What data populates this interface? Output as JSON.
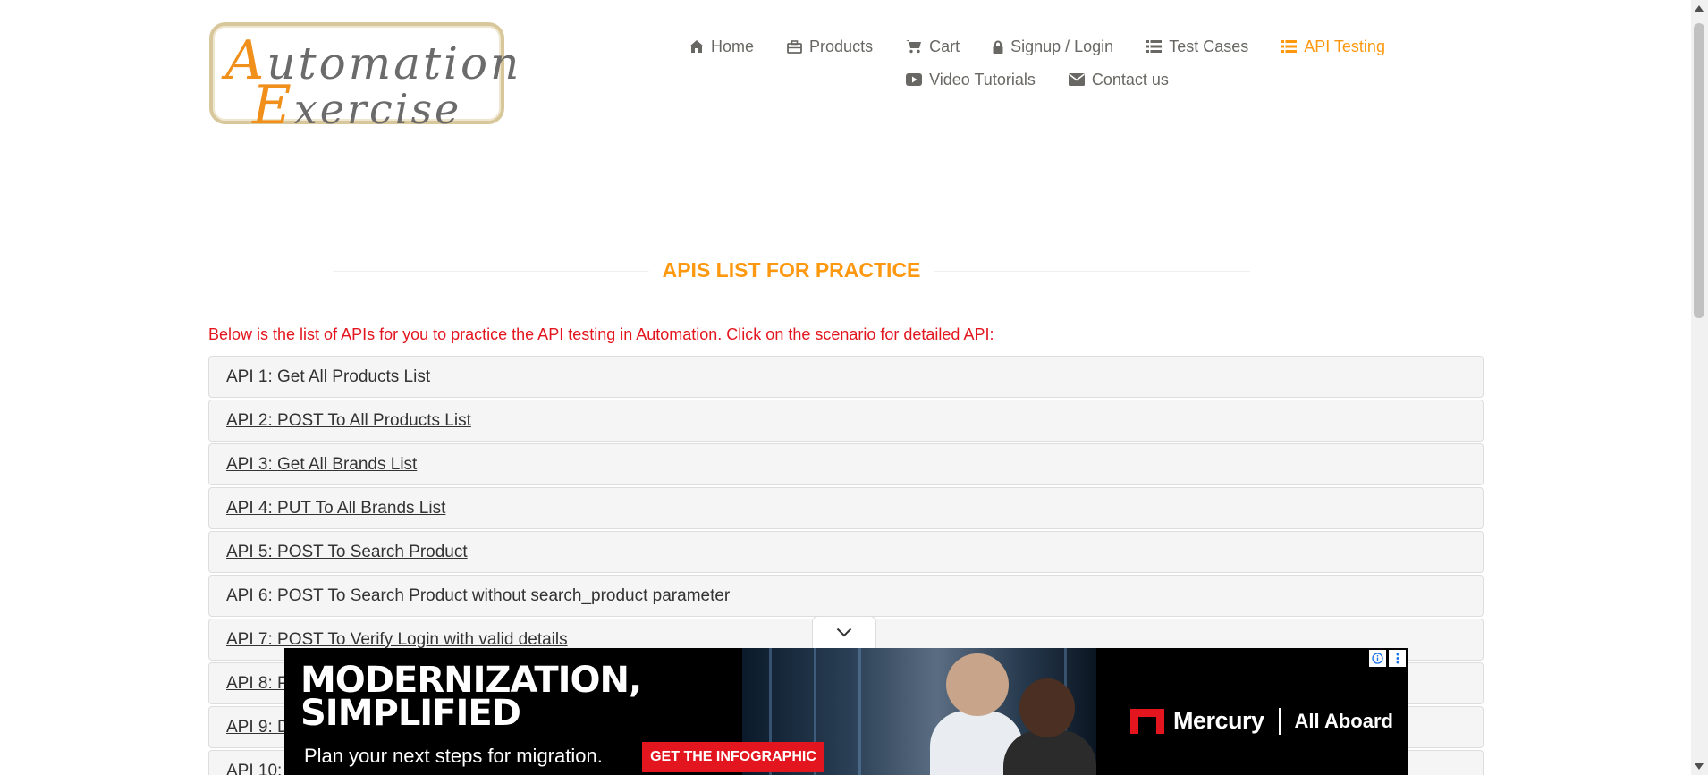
{
  "logo": {
    "line1_cap": "A",
    "line1_rest": "utomation",
    "line2_cap": "E",
    "line2_rest": "xercise"
  },
  "nav": {
    "row1": [
      {
        "label": "Home",
        "icon": "home-icon"
      },
      {
        "label": "Products",
        "icon": "briefcase-icon"
      },
      {
        "label": "Cart",
        "icon": "cart-icon"
      },
      {
        "label": "Signup / Login",
        "icon": "lock-icon"
      },
      {
        "label": "Test Cases",
        "icon": "list-icon"
      },
      {
        "label": "API Testing",
        "icon": "list-icon",
        "active": true
      }
    ],
    "row2": [
      {
        "label": "Video Tutorials",
        "icon": "youtube-play-icon"
      },
      {
        "label": "Contact us",
        "icon": "envelope-icon"
      }
    ]
  },
  "page_title": "APIs List for practice",
  "intro": "Below is the list of APIs for you to practice the API testing in Automation. Click on the scenario for detailed API:",
  "apis": [
    "API 1: Get All Products List",
    "API 2: POST To All Products List",
    "API 3: Get All Brands List",
    "API 4: PUT To All Brands List",
    "API 5: POST To Search Product",
    "API 6: POST To Search Product without search_product parameter",
    "API 7: POST To Verify Login with valid details",
    "API 8: P",
    "API 9: D",
    "API 10:"
  ],
  "ad": {
    "headline": "MODERNIZATION,\nSIMPLIFIED",
    "subtext": "Plan your next steps for migration.",
    "cta": "GET THE INFOGRAPHIC",
    "brand": "Mercury",
    "tagline": "All Aboard"
  },
  "colors": {
    "accent": "#fe980f",
    "intro_red": "#e3161f",
    "nav_text": "#696763"
  }
}
